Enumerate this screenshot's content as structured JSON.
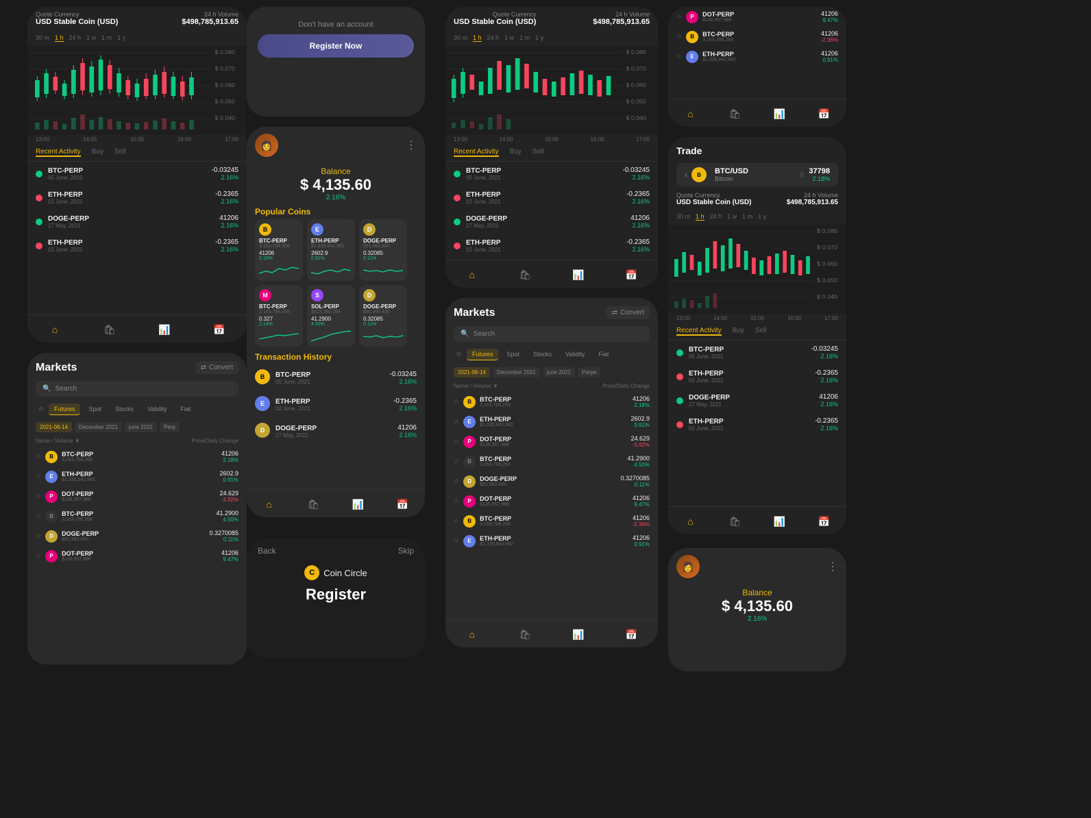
{
  "phones": {
    "p1": {
      "quote_label": "Quote Currency",
      "quote_currency": "USD Stable Coin (USD)",
      "volume_label": "24 h Volume",
      "volume_value": "$498,785,913.65",
      "time_tabs": [
        "30 m",
        "1 h",
        "24 h",
        "1 w",
        "1 m",
        "1 y"
      ],
      "active_tab": "1 h",
      "activity_tabs": [
        "Recent Activity",
        "Buy",
        "Sell"
      ],
      "active_activity": "Recent Activity",
      "price_levels": [
        "$ 0.080",
        "$ 0.070",
        "$ 0.060",
        "$ 0.050",
        "$ 0.040"
      ],
      "time_labels": [
        "13:00",
        "14:00",
        "15:00",
        "16:00",
        "17:00"
      ],
      "coins": [
        {
          "name": "BTC-PERP",
          "date": "05 June, 2021",
          "color": "green",
          "price": "-0.03245",
          "pct": "2.16%",
          "pct_type": "green"
        },
        {
          "name": "ETH-PERP",
          "date": "02 June, 2021",
          "color": "red",
          "price": "-0.2365",
          "pct": "2.16%",
          "pct_type": "green"
        },
        {
          "name": "DOGE-PERP",
          "date": "27 May, 2021",
          "color": "green",
          "price": "41206",
          "pct": "2.16%",
          "pct_type": "green"
        },
        {
          "name": "ETH-PERP",
          "date": "02 June, 2021",
          "color": "red",
          "price": "-0.2365",
          "pct": "2.16%",
          "pct_type": "green"
        }
      ],
      "nav": [
        "home",
        "shop",
        "chart",
        "calendar"
      ]
    },
    "p2": {
      "dont_have": "Don't have an account",
      "register_btn": "Register Now"
    },
    "p3": {
      "balance_label": "Balance",
      "balance_amount": "$ 4,135.60",
      "balance_pct": "2.16%",
      "popular_title": "Popular Coins",
      "coins": [
        {
          "symbol": "B",
          "name": "BTC-PERP",
          "sub": "3,163,766,358",
          "price": "41206",
          "pct": "2.16%",
          "pct_type": "green",
          "type": "btc"
        },
        {
          "symbol": "E",
          "name": "ETH-PERP",
          "sub": "$1,335,942,982",
          "price": "2602.9",
          "pct": "0.91%",
          "pct_type": "green",
          "type": "eth"
        },
        {
          "symbol": "D",
          "name": "DOGE-PERP",
          "sub": "$91,983,400",
          "price": "0.32085",
          "pct": "0.11%",
          "pct_type": "green",
          "type": "doge"
        },
        {
          "symbol": "M",
          "name": "BTC-PERP",
          "sub": "3,163,766,268",
          "price": "0.327",
          "pct": "2.14%",
          "pct_type": "green",
          "type": "dot"
        },
        {
          "symbol": "S",
          "name": "SOL-PERP",
          "sub": "$123,380,399",
          "price": "41.2900",
          "pct": "4.50%",
          "pct_type": "green",
          "type": "sol"
        },
        {
          "symbol": "D",
          "name": "DOGE-PERP",
          "sub": "$91,983,400",
          "price": "0.32085",
          "pct": "0.11%",
          "pct_type": "green",
          "type": "doge"
        }
      ],
      "transaction_title": "Transaction History",
      "transactions": [
        {
          "name": "BTC-PERP",
          "date": "05 June, 2021",
          "price": "-0.03245",
          "pct": "2.16%",
          "pct_type": "green",
          "type": "btc"
        },
        {
          "name": "ETH-PERP",
          "date": "02 June, 2021",
          "price": "-0.2365",
          "pct": "2.16%",
          "pct_type": "green",
          "type": "eth"
        },
        {
          "name": "DOGE-PERP",
          "date": "27 May, 2021",
          "price": "41206",
          "pct": "2.16%",
          "pct_type": "green",
          "type": "doge"
        }
      ],
      "nav": [
        "home",
        "shop",
        "chart",
        "calendar"
      ]
    },
    "p4": {
      "quote_label": "Quote Currency",
      "quote_currency": "USD Stable Coin (USD)",
      "volume_label": "24 h Volume",
      "volume_value": "$498,785,913.65",
      "time_tabs": [
        "30 m",
        "1 h",
        "24 h",
        "1 w",
        "1 m",
        "1 y"
      ],
      "active_tab": "1 h",
      "activity_tabs": [
        "Recent Activity",
        "Buy",
        "Sell"
      ],
      "active_activity": "Recent Activity",
      "coins": [
        {
          "name": "BTC-PERP",
          "date": "05 June, 2021",
          "color": "green",
          "price": "-0.03245",
          "pct": "2.16%",
          "pct_type": "green"
        },
        {
          "name": "ETH-PERP",
          "date": "02 June, 2021",
          "color": "red",
          "price": "-0.2365",
          "pct": "2.16%",
          "pct_type": "green"
        },
        {
          "name": "DOGE-PERP",
          "date": "27 May, 2021",
          "color": "green",
          "price": "41206",
          "pct": "2.16%",
          "pct_type": "green"
        },
        {
          "name": "ETH-PERP",
          "date": "02 June, 2021",
          "color": "red",
          "price": "-0.2365",
          "pct": "2.16%",
          "pct_type": "green"
        }
      ],
      "nav": [
        "home",
        "shop",
        "chart",
        "calendar"
      ]
    },
    "p5": {
      "coins": [
        {
          "name": "DOT-PERP",
          "sub": "$136,957,986",
          "price": "41206",
          "pct": "9.47%",
          "pct_type": "green",
          "type": "dot"
        },
        {
          "name": "BTC-PERP",
          "sub": "3,163,788,268",
          "price": "41206",
          "pct": "-2.36%",
          "pct_type": "red",
          "type": "btc"
        },
        {
          "name": "ETH-PERP",
          "sub": "$1,335,942,982",
          "price": "41206",
          "pct": "0.91%",
          "pct_type": "green",
          "type": "eth"
        }
      ],
      "nav": [
        "home",
        "shop",
        "chart",
        "calendar"
      ]
    },
    "p6": {
      "title": "Markets",
      "convert_label": "Convert",
      "search_placeholder": "Search",
      "filter_tabs": [
        "Futures",
        "Spot",
        "Stocks",
        "Validity",
        "Fiat"
      ],
      "active_filter": "Futures",
      "date_tabs": [
        "2021-06-14",
        "December 2021",
        "june 2021",
        "Perp"
      ],
      "col_name": "Name / Volume",
      "col_price": "Price/Daily Change",
      "markets": [
        {
          "name": "BTC-PERP",
          "sub": "3,163,766,268",
          "price": "41206",
          "pct": "2.18%",
          "pct_type": "green",
          "type": "btc"
        },
        {
          "name": "ETH-PERP",
          "sub": "$1,335,942,982",
          "price": "2602.9",
          "pct": "0.91%",
          "pct_type": "green",
          "type": "eth"
        },
        {
          "name": "DOT-PERP",
          "sub": "$136,957,986",
          "price": "24.629",
          "pct": "-3.92%",
          "pct_type": "red",
          "type": "dot"
        },
        {
          "name": "BTC-PERP",
          "sub": "3,163,766,268",
          "price": "41.2900",
          "pct": "4.50%",
          "pct_type": "green",
          "type": "btc"
        },
        {
          "name": "DOGE-PERP",
          "sub": "$91,983,400",
          "price": "0.3270085",
          "pct": "0.11%",
          "pct_type": "green",
          "type": "doge"
        },
        {
          "name": "DOT-PERP",
          "sub": "$136,957,986",
          "price": "41206",
          "pct": "9.47%",
          "pct_type": "green",
          "type": "dot"
        }
      ]
    },
    "p7": {
      "title": "Markets",
      "convert_label": "Convert",
      "search_placeholder": "Search",
      "filter_tabs": [
        "Futures",
        "Spot",
        "Stocks",
        "Validity",
        "Fiat"
      ],
      "active_filter": "Futures",
      "date_tabs": [
        "2021-06-14",
        "December 2021",
        "june 2021",
        "Perpe"
      ],
      "col_name": "Name / Volume",
      "col_price": "Price/Daily Change",
      "markets": [
        {
          "name": "BTC-PERP",
          "sub": "3,163,766,268",
          "price": "41206",
          "pct": "2.18%",
          "pct_type": "green",
          "type": "btc"
        },
        {
          "name": "ETH-PERP",
          "sub": "$1,335,942,982",
          "price": "2602.9",
          "pct": "0.91%",
          "pct_type": "green",
          "type": "eth"
        },
        {
          "name": "DOT-PERP",
          "sub": "$136,957,986",
          "price": "24.629",
          "pct": "-3.92%",
          "pct_type": "red",
          "type": "dot"
        },
        {
          "name": "BTC-PERP",
          "sub": "3,163,766,268",
          "price": "41.2900",
          "pct": "4.50%",
          "pct_type": "green",
          "type": "btc"
        },
        {
          "name": "DOGE-PERP",
          "sub": "$91,983,400",
          "price": "0.3270085",
          "pct": "0.11%",
          "pct_type": "green",
          "type": "doge"
        },
        {
          "name": "DOT-PERP",
          "sub": "$136,957,986",
          "price": "41206",
          "pct": "9.47%",
          "pct_type": "green",
          "type": "dot"
        },
        {
          "name": "BTC-PERP",
          "sub": "3,163,788,268",
          "price": "41206",
          "pct": "-2.36%",
          "pct_type": "red",
          "type": "btc"
        },
        {
          "name": "ETH-PERP",
          "sub": "$1,335,942,982",
          "price": "41206",
          "pct": "0.91%",
          "pct_type": "green",
          "type": "eth"
        }
      ]
    },
    "p8": {
      "back_label": "Back",
      "skip_label": "Skip",
      "logo_letter": "C",
      "app_name": "Coin Circle",
      "register_label": "Register"
    },
    "p9": {
      "trade_title": "Trade",
      "coin_pair": "BTC/USD",
      "coin_sub": "Bitcoin",
      "star": "☆",
      "price": "37798",
      "pct": "2.18%",
      "quote_label": "Quote Currency",
      "quote_currency": "USD Stable Coin (USD)",
      "volume_label": "24 h Volume",
      "volume_value": "$498,785,913.65",
      "time_tabs": [
        "30 m",
        "1 h",
        "24 h",
        "1 w",
        "1 m",
        "1 y"
      ],
      "active_tab": "1 h",
      "activity_tabs": [
        "Recent Activity",
        "Buy",
        "Sell"
      ],
      "active_activity": "Recent Activity",
      "coins": [
        {
          "name": "BTC-PERP",
          "date": "05 June, 2021",
          "color": "green",
          "price": "-0.03245",
          "pct": "2.16%",
          "pct_type": "green"
        },
        {
          "name": "ETH-PERP",
          "date": "02 June, 2021",
          "color": "red",
          "price": "-0.2365",
          "pct": "2.16%",
          "pct_type": "green"
        },
        {
          "name": "DOGE-PERP",
          "date": "27 May, 2021",
          "color": "green",
          "price": "41206",
          "pct": "2.16%",
          "pct_type": "green"
        },
        {
          "name": "ETH-PERP",
          "date": "02 June, 2021",
          "color": "red",
          "price": "-0.2365",
          "pct": "2.16%",
          "pct_type": "green"
        }
      ],
      "nav": [
        "home",
        "shop",
        "chart",
        "calendar"
      ]
    },
    "p10": {
      "balance_label": "Balance",
      "balance_amount": "$ 4,135.60",
      "balance_pct": "2.16%"
    }
  }
}
